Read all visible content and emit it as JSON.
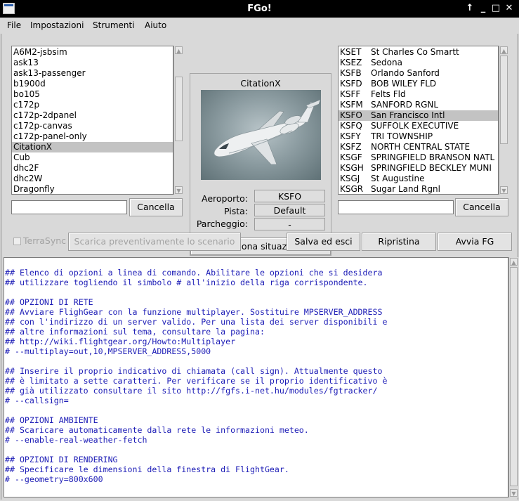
{
  "window": {
    "title": "FGo!"
  },
  "menu": [
    "File",
    "Impostazioni",
    "Strumenti",
    "Aiuto"
  ],
  "aircraft_list": {
    "items": [
      "A6M2-jsbsim",
      "ask13",
      "ask13-passenger",
      "b1900d",
      "bo105",
      "c172p",
      "c172p-2dpanel",
      "c172p-canvas",
      "c172p-panel-only",
      "CitationX",
      "Cub",
      "dhc2F",
      "dhc2W",
      "Dragonfly"
    ],
    "selected": "CitationX",
    "search_value": "",
    "cancel_label": "Cancella"
  },
  "aircraft_panel": {
    "name": "CitationX",
    "airport_label": "Aeroporto:",
    "airport_value": "KSFO",
    "runway_label": "Pista:",
    "runway_value": "Default",
    "parking_label": "Parcheggio:",
    "parking_value": "-",
    "select_scenario_label": "Seleziona situazione"
  },
  "airport_list": {
    "items": [
      {
        "code": "KSET",
        "name": "St Charles Co Smartt"
      },
      {
        "code": "KSEZ",
        "name": "Sedona"
      },
      {
        "code": "KSFB",
        "name": "Orlando Sanford"
      },
      {
        "code": "KSFD",
        "name": "BOB WILEY FLD"
      },
      {
        "code": "KSFF",
        "name": "Felts Fld"
      },
      {
        "code": "KSFM",
        "name": "SANFORD RGNL"
      },
      {
        "code": "KSFO",
        "name": "San Francisco Intl"
      },
      {
        "code": "KSFQ",
        "name": "SUFFOLK EXECUTIVE"
      },
      {
        "code": "KSFY",
        "name": "TRI TOWNSHIP"
      },
      {
        "code": "KSFZ",
        "name": "NORTH CENTRAL STATE"
      },
      {
        "code": "KSGF",
        "name": "SPRINGFIELD BRANSON NATL"
      },
      {
        "code": "KSGH",
        "name": "SPRINGFIELD BECKLEY MUNI"
      },
      {
        "code": "KSGJ",
        "name": "St Augustine"
      },
      {
        "code": "KSGR",
        "name": "Sugar Land Rgnl"
      }
    ],
    "selected": "KSFO",
    "search_value": "",
    "cancel_label": "Cancella"
  },
  "controls": {
    "terrasync_label": "TerraSync",
    "terrasync_checked": false,
    "prefetch_label": "Scarica preventivamente lo scenario",
    "save_exit_label": "Salva ed esci",
    "reset_label": "Ripristina",
    "run_label": "Avvia FG"
  },
  "editor_lines": [
    "## Elenco di opzioni a linea di comando. Abilitare le opzioni che si desidera",
    "## utilizzare togliendo il simbolo # all'inizio della riga corrispondente.",
    "",
    "## OPZIONI DI RETE",
    "## Avviare FlighGear con la funzione multiplayer. Sostituire MPSERVER_ADDRESS",
    "## con l'indirizzo di un server valido. Per una lista dei server disponibili e",
    "## altre informazioni sul tema, consultare la pagina:",
    "## http://wiki.flightgear.org/Howto:Multiplayer",
    "# --multiplay=out,10,MPSERVER_ADDRESS,5000",
    "",
    "## Inserire il proprio indicativo di chiamata (call sign). Attualmente questo",
    "## è limitato a sette caratteri. Per verificare se il proprio identificativo è",
    "## già utilizzato consultare il sito http://fgfs.i-net.hu/modules/fgtracker/",
    "# --callsign=",
    "",
    "## OPZIONI AMBIENTE",
    "## Scaricare automaticamente dalla rete le informazioni meteo.",
    "# --enable-real-weather-fetch",
    "",
    "## OPZIONI DI RENDERING",
    "## Specificare le dimensioni della finestra di FlightGear.",
    "# --geometry=800x600"
  ]
}
